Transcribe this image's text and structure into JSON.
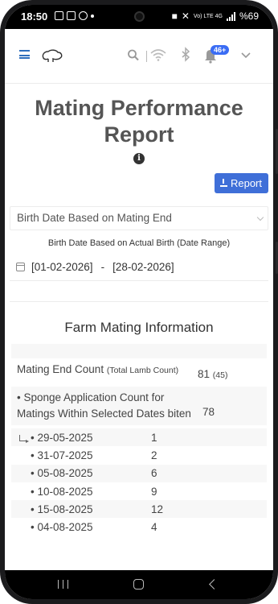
{
  "status_bar": {
    "time": "18:50",
    "network_label": "Vo) LTE 4G",
    "battery": "%69"
  },
  "header": {
    "notification_badge": "46+",
    "icons": [
      "menu-icon",
      "sheep-logo-icon",
      "search-icon",
      "wifi-icon",
      "bluetooth-icon",
      "bell-icon",
      "chevron-down-icon"
    ]
  },
  "page": {
    "title": "Mating Performance Report",
    "info_glyph": "i",
    "report_button_label": "Report",
    "date_basis_select": "Birth Date Based on Mating End",
    "date_range_label": "Birth Date Based on Actual Birth (Date Range)",
    "date_from": "[01-02-2026]",
    "date_separator": "-",
    "date_to": "[28-02-2026]"
  },
  "farm_info": {
    "section_title": "Farm Mating Information",
    "mating_end": {
      "label": "Mating End Count",
      "sub_label": "(Total Lamb Count)",
      "value": "81",
      "sub_value": "(45)"
    },
    "sponge": {
      "label": "• Sponge Application Count for Matings Within Selected Dates biten",
      "value": "78"
    },
    "dates": [
      {
        "date": "• 29-05-2025",
        "count": "1"
      },
      {
        "date": "• 31-07-2025",
        "count": "2"
      },
      {
        "date": "• 05-08-2025",
        "count": "6"
      },
      {
        "date": "• 10-08-2025",
        "count": "9"
      },
      {
        "date": "• 15-08-2025",
        "count": "12"
      },
      {
        "date": "• 04-08-2025",
        "count": "4"
      }
    ]
  },
  "colors": {
    "accent": "#3f6fd8",
    "menu_blue": "#2f6fbd",
    "badge": "#3a6cf4"
  }
}
